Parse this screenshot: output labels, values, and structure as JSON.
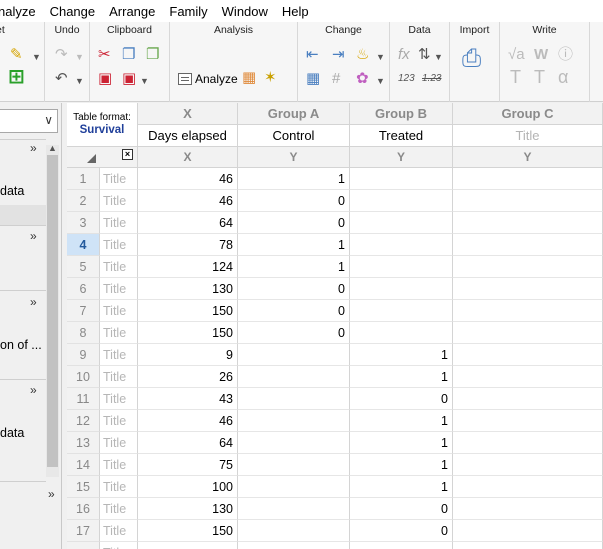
{
  "menu": [
    "nalyze",
    "Change",
    "Arrange",
    "Family",
    "Window",
    "Help"
  ],
  "ribbon": {
    "groups": [
      {
        "title": "et"
      },
      {
        "title": "Undo"
      },
      {
        "title": "Clipboard"
      },
      {
        "title": "Analysis"
      },
      {
        "title": "Change"
      },
      {
        "title": "Data"
      },
      {
        "title": "Import"
      },
      {
        "title": "Write"
      }
    ],
    "analyze_label": "Analyze",
    "data_labels": {
      "format_123": "123",
      "format_123b": "1.23"
    }
  },
  "navigator": {
    "items": [
      {
        "text": "data"
      },
      {
        "text": "on of ..."
      },
      {
        "text": "data"
      }
    ]
  },
  "table": {
    "format_label": "Table format:",
    "format_value": "Survival",
    "columns": [
      {
        "header": "X",
        "title": "Days elapsed",
        "sub": "X",
        "placeholder": false
      },
      {
        "header": "Group A",
        "title": "Control",
        "sub": "Y",
        "placeholder": false
      },
      {
        "header": "Group B",
        "title": "Treated",
        "sub": "Y",
        "placeholder": false
      },
      {
        "header": "Group C",
        "title": "Title",
        "sub": "Y",
        "placeholder": true
      }
    ],
    "row_title_placeholder": "Title",
    "active_row": 4,
    "rows": [
      {
        "n": "1",
        "x": "46",
        "a": "1",
        "b": ""
      },
      {
        "n": "2",
        "x": "46",
        "a": "0",
        "b": ""
      },
      {
        "n": "3",
        "x": "64",
        "a": "0",
        "b": ""
      },
      {
        "n": "4",
        "x": "78",
        "a": "1",
        "b": ""
      },
      {
        "n": "5",
        "x": "124",
        "a": "1",
        "b": ""
      },
      {
        "n": "6",
        "x": "130",
        "a": "0",
        "b": ""
      },
      {
        "n": "7",
        "x": "150",
        "a": "0",
        "b": ""
      },
      {
        "n": "8",
        "x": "150",
        "a": "0",
        "b": ""
      },
      {
        "n": "9",
        "x": "9",
        "a": "",
        "b": "1"
      },
      {
        "n": "10",
        "x": "26",
        "a": "",
        "b": "1"
      },
      {
        "n": "11",
        "x": "43",
        "a": "",
        "b": "0"
      },
      {
        "n": "12",
        "x": "46",
        "a": "",
        "b": "1"
      },
      {
        "n": "13",
        "x": "64",
        "a": "",
        "b": "1"
      },
      {
        "n": "14",
        "x": "75",
        "a": "",
        "b": "1"
      },
      {
        "n": "15",
        "x": "100",
        "a": "",
        "b": "1"
      },
      {
        "n": "16",
        "x": "130",
        "a": "",
        "b": "0"
      },
      {
        "n": "17",
        "x": "150",
        "a": "",
        "b": "0"
      }
    ]
  }
}
